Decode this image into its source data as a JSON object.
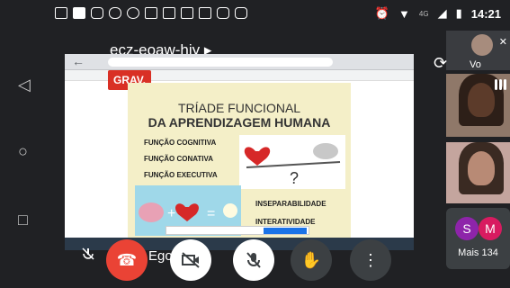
{
  "status_bar": {
    "time": "14:21",
    "network": "4G"
  },
  "meeting": {
    "code": "ecz-eoaw-hiy ▸"
  },
  "recording_badge": "GRAV.",
  "slide": {
    "title_line1": "TRÍADE FUNCIONAL",
    "title_line2": "DA APRENDIZAGEM HUMANA",
    "functions": [
      "FUNÇÃO COGNITIVA",
      "FUNÇÃO CONATIVA",
      "FUNÇÃO EXECUTIVA"
    ],
    "keywords": [
      "INSEPARABILIDADE",
      "INTERATIVIDADE"
    ]
  },
  "presenter": {
    "name": "Ego   ne"
  },
  "self_tile": {
    "label": "Vo"
  },
  "others": {
    "avatars": [
      "S",
      "M"
    ],
    "more_label": "Mais 134"
  },
  "colors": {
    "end_call": "#ea4335",
    "recording": "#d93025",
    "avatar_s": "#8e24aa",
    "avatar_m": "#d81b60"
  }
}
